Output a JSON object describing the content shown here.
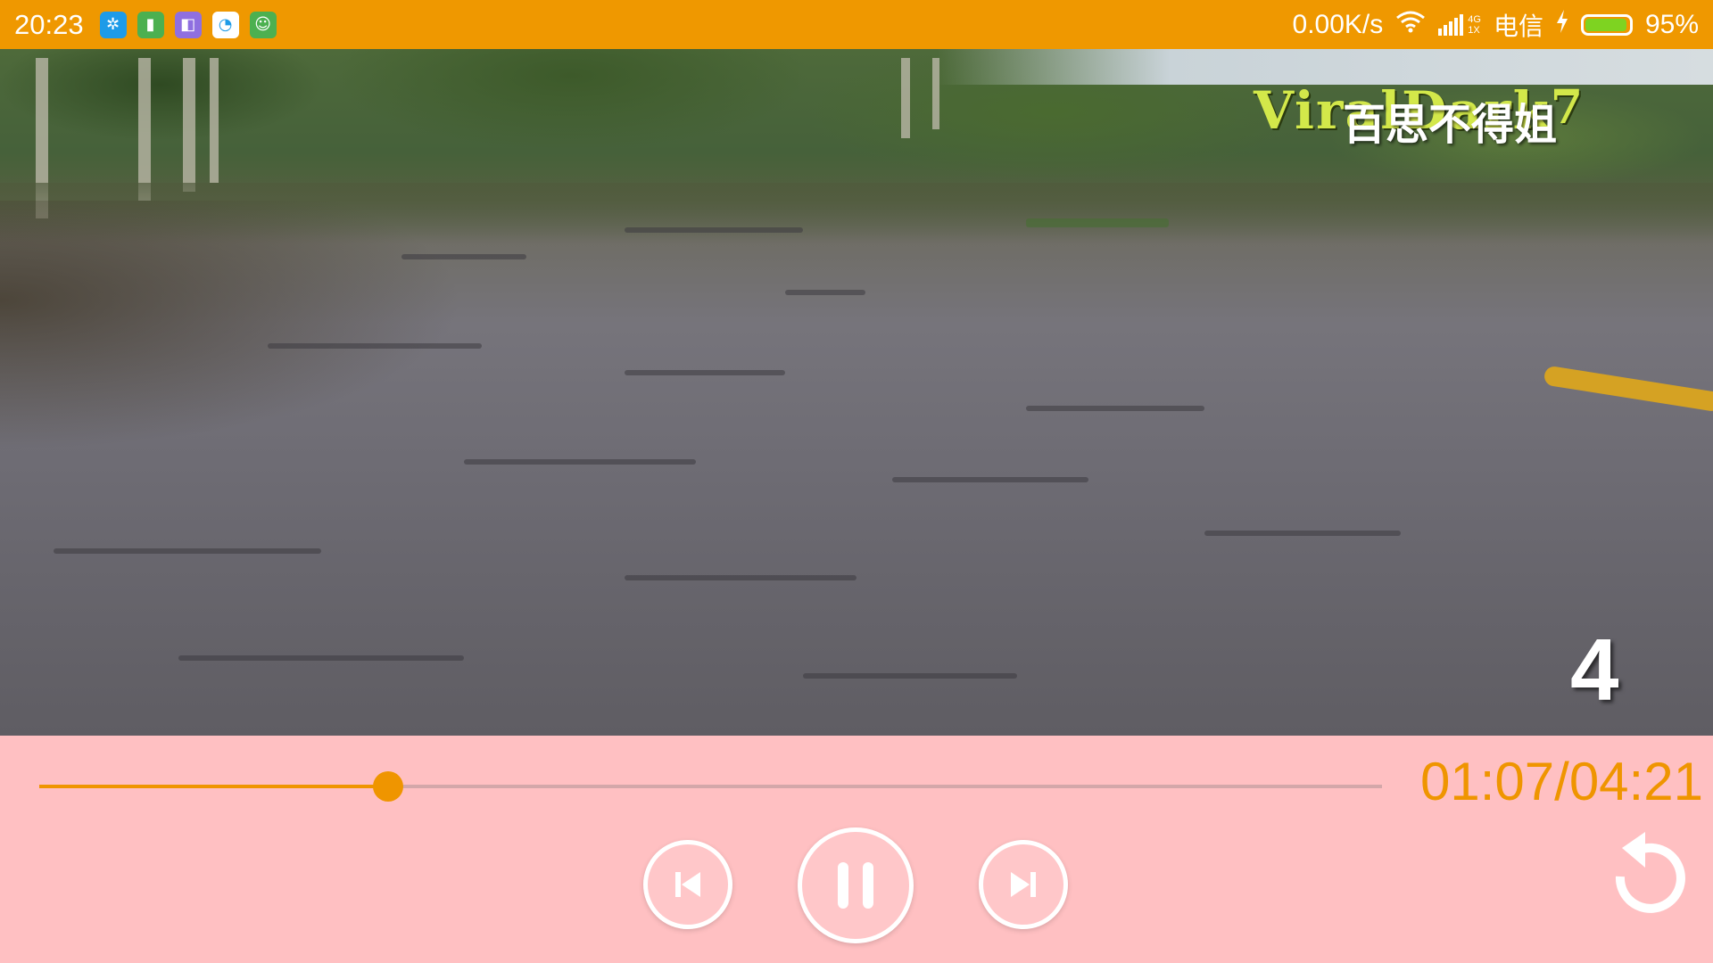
{
  "status_bar": {
    "time": "20:23",
    "app_icons": [
      {
        "name": "alipay-icon",
        "color": "#1e9be8",
        "glyph": "✲"
      },
      {
        "name": "sim-card-icon",
        "color": "#4cb050",
        "glyph": "▮"
      },
      {
        "name": "purple-app-icon",
        "color": "#8f6fe0",
        "glyph": "◧"
      },
      {
        "name": "sync-app-icon",
        "color": "#ffffff",
        "glyph": "◔"
      },
      {
        "name": "android-icon",
        "color": "#4cb050",
        "glyph": "☺"
      }
    ],
    "network_speed": "0.00K/s",
    "network_type": "4G",
    "network_type_2": "1X",
    "carrier": "电信",
    "battery_percent": "95%",
    "battery_level": 0.95
  },
  "video": {
    "watermark_top": "ViralDark",
    "watermark_number": "7",
    "watermark_cn": "百思不得姐",
    "episode_number": "4"
  },
  "controls": {
    "current_time": "01:07",
    "total_time": "04:21",
    "time_display": "01:07/04:21",
    "progress": 0.26,
    "accent_color": "#ef9500",
    "panel_color": "#ffc0c2",
    "buttons": {
      "previous": "skip-previous-icon",
      "pause": "pause-icon",
      "next": "skip-next-icon",
      "replay": "replay-icon"
    }
  }
}
